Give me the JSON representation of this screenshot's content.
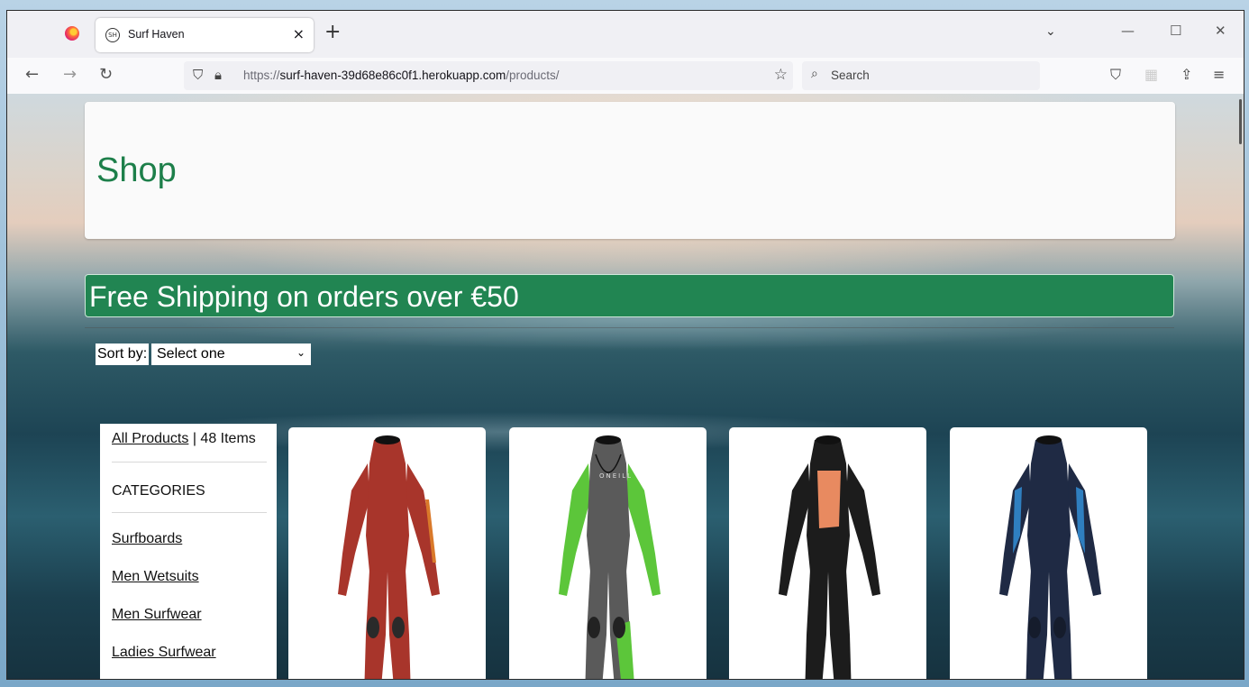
{
  "browser": {
    "tab_title": "Surf Haven",
    "tab_favicon_text": "SH",
    "url_prefix": "https://",
    "url_domain": "surf-haven-39d68e86c0f1.herokuapp.com",
    "url_path": "/products/",
    "search_placeholder": "Search",
    "icons": {
      "back": "arrow-left-icon",
      "forward": "arrow-right-icon",
      "reload": "reload-icon",
      "shield": "tracking-shield-icon",
      "lock": "lock-icon",
      "bookmark": "star-icon",
      "pocket": "pocket-icon",
      "extensions": "extension-icon",
      "share": "share-icon",
      "menu": "hamburger-menu-icon"
    }
  },
  "page": {
    "title": "Shop",
    "promo_banner": "Free Shipping on orders over €50",
    "sort": {
      "label": "Sort by:",
      "selected": "Select one"
    },
    "sidebar": {
      "all_products_link": "All Products",
      "item_count": " | 48 Items",
      "categories_heading": "CATEGORIES",
      "categories": [
        "Surfboards",
        "Men Wetsuits",
        "Men Surfwear",
        "Ladies Surfwear"
      ]
    },
    "products": [
      {
        "alt": "red wetsuit",
        "colors": {
          "body": "#a8352b",
          "accent": "#d9792a",
          "knee": "#2a2a2a"
        }
      },
      {
        "alt": "O'Neill green and grey wetsuit",
        "brand_text": "ONEILL",
        "colors": {
          "body": "#5a5a5a",
          "accent": "#5cc63a",
          "knee": "#222"
        }
      },
      {
        "alt": "black wetsuit with orange chest",
        "colors": {
          "body": "#1c1c1c",
          "accent": "#e88a60",
          "knee": "#1c1c1c"
        }
      },
      {
        "alt": "navy and blue wetsuit",
        "colors": {
          "body": "#1f2a44",
          "accent": "#2f7fc0",
          "knee": "#151c2c"
        }
      }
    ],
    "colors": {
      "brand_green": "#218552",
      "title_green": "#1d7f4a"
    }
  }
}
